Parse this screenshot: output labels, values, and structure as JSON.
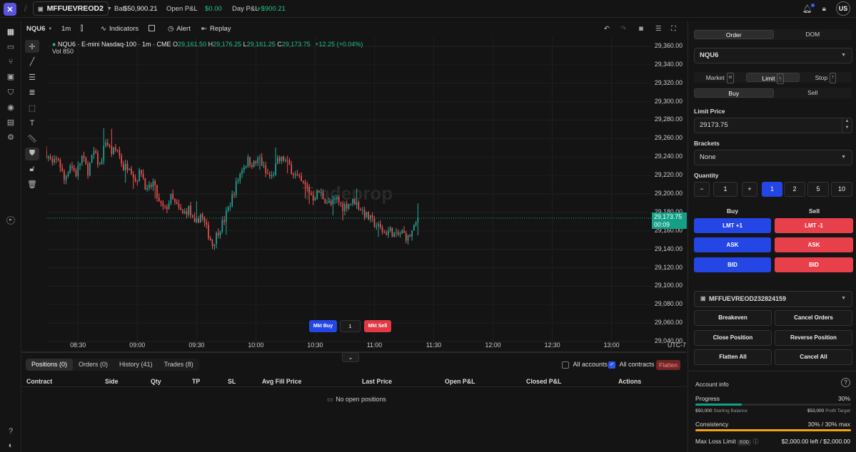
{
  "topbar": {
    "account": "MFFUEVREOD2",
    "bal_label": "Bal",
    "bal_value": "$50,900.21",
    "open_pnl_label": "Open P&L",
    "open_pnl_value": "$0.00",
    "day_pnl_label": "Day P&L",
    "day_pnl_value": "+$900.21",
    "user_initials": "US"
  },
  "chart_toolbar": {
    "symbol": "NQU6",
    "interval": "1m",
    "indicators": "Indicators",
    "alert": "Alert",
    "replay": "Replay"
  },
  "legend": {
    "title": "NQU6 · E-mini Nasdaq-100 · 1m · CME",
    "o_label": "O",
    "o": "29,161.50",
    "h_label": "H",
    "h": "29,176.25",
    "l_label": "L",
    "l": "29,161.25",
    "c_label": "C",
    "c": "29,173.75",
    "change": "+12.25 (+0.04%)",
    "vol": "Vol 850"
  },
  "watermark": "Tradeprop",
  "current_price": "29,173.75",
  "countdown": "00:09",
  "timezone": "UTC-7",
  "mkt": {
    "buy": "Mkt Buy",
    "qty": "1",
    "sell": "Mkt Sell"
  },
  "colors": {
    "up": "#26a69a",
    "down": "#ef5350",
    "accent": "#2446e5",
    "sell": "#e8404b",
    "progress": "#14a087",
    "consistency": "#f4a316"
  },
  "chart_data": {
    "type": "candlestick",
    "symbol": "NQU6",
    "interval": "1m",
    "ylim": [
      29030,
      29370
    ],
    "y_ticks": [
      29040,
      29060,
      29080,
      29100,
      29120,
      29140,
      29160,
      29180,
      29200,
      29220,
      29240,
      29260,
      29280,
      29300,
      29320,
      29340,
      29360
    ],
    "y_tick_labels": [
      "29,040.00",
      "29,060.00",
      "29,080.00",
      "29,100.00",
      "29,120.00",
      "29,140.00",
      "29,160.00",
      "29,180.00",
      "29,200.00",
      "29,220.00",
      "29,240.00",
      "29,260.00",
      "29,280.00",
      "29,300.00",
      "29,320.00",
      "29,340.00",
      "29,360.00"
    ],
    "x_ticks": [
      "08:30",
      "09:00",
      "09:30",
      "10:00",
      "10:30",
      "11:00",
      "11:30",
      "12:00",
      "12:30",
      "13:00"
    ],
    "x_tick_minutes": [
      510,
      540,
      570,
      600,
      630,
      660,
      690,
      720,
      750,
      780
    ],
    "x_range_minutes": [
      494,
      800
    ],
    "close_path": [
      [
        494,
        29244
      ],
      [
        497,
        29232
      ],
      [
        500,
        29238
      ],
      [
        503,
        29215
      ],
      [
        506,
        29232
      ],
      [
        509,
        29222
      ],
      [
        512,
        29240
      ],
      [
        515,
        29225
      ],
      [
        518,
        29245
      ],
      [
        521,
        29230
      ],
      [
        524,
        29258
      ],
      [
        527,
        29245
      ],
      [
        530,
        29248
      ],
      [
        533,
        29228
      ],
      [
        536,
        29232
      ],
      [
        539,
        29215
      ],
      [
        542,
        29225
      ],
      [
        545,
        29202
      ],
      [
        548,
        29212
      ],
      [
        551,
        29190
      ],
      [
        554,
        29182
      ],
      [
        557,
        29196
      ],
      [
        560,
        29186
      ],
      [
        563,
        29178
      ],
      [
        566,
        29184
      ],
      [
        569,
        29165
      ],
      [
        572,
        29178
      ],
      [
        575,
        29162
      ],
      [
        578,
        29145
      ],
      [
        581,
        29160
      ],
      [
        584,
        29172
      ],
      [
        587,
        29190
      ],
      [
        590,
        29210
      ],
      [
        593,
        29228
      ],
      [
        596,
        29236
      ],
      [
        599,
        29232
      ],
      [
        602,
        29238
      ],
      [
        605,
        29222
      ],
      [
        608,
        29218
      ],
      [
        611,
        29235
      ],
      [
        614,
        29238
      ],
      [
        617,
        29230
      ],
      [
        620,
        29220
      ],
      [
        623,
        29212
      ],
      [
        626,
        29206
      ],
      [
        629,
        29196
      ],
      [
        632,
        29202
      ],
      [
        635,
        29194
      ],
      [
        638,
        29188
      ],
      [
        641,
        29194
      ],
      [
        644,
        29186
      ],
      [
        647,
        29190
      ],
      [
        650,
        29192
      ],
      [
        653,
        29184
      ],
      [
        656,
        29176
      ],
      [
        659,
        29170
      ],
      [
        662,
        29164
      ],
      [
        665,
        29158
      ],
      [
        668,
        29160
      ],
      [
        671,
        29154
      ],
      [
        674,
        29158
      ],
      [
        677,
        29152
      ],
      [
        680,
        29162
      ],
      [
        682,
        29174
      ]
    ],
    "last_price": 29173.75
  },
  "positions_tabs": [
    "Positions (0)",
    "Orders (0)",
    "History (41)",
    "Trades (8)"
  ],
  "filters": {
    "all_accounts": "All accounts",
    "all_contracts": "All contracts",
    "flatten": "Flatten"
  },
  "table_headers": [
    "Contract",
    "Side",
    "Qty",
    "TP",
    "SL",
    "Avg Fill Price",
    "Last Price",
    "Open P&L",
    "Closed P&L",
    "Actions"
  ],
  "empty_text": "No open positions",
  "panel": {
    "tabs": [
      "Order",
      "DOM"
    ],
    "symbol": "NQU6",
    "order_types": [
      {
        "label": "Market",
        "key": "M"
      },
      {
        "label": "Limit",
        "key": "L"
      },
      {
        "label": "Stop",
        "key": "T"
      }
    ],
    "side_tabs": [
      "Buy",
      "Sell"
    ],
    "limit_price_label": "Limit Price",
    "limit_price": "29173.75",
    "brackets_label": "Brackets",
    "brackets": "None",
    "quantity_label": "Quantity",
    "quantity": "1",
    "presets": [
      "1",
      "2",
      "5",
      "10"
    ],
    "buy_header": "Buy",
    "sell_header": "Sell",
    "buy_buttons": [
      "LMT +1",
      "ASK",
      "BID"
    ],
    "sell_buttons": [
      "LMT -1",
      "ASK",
      "BID"
    ],
    "account_select": "MFFUEVREOD232824159",
    "actions": [
      "Breakeven",
      "Cancel Orders",
      "Close Position",
      "Reverse Position",
      "Flatten All",
      "Cancel All"
    ],
    "account_info": "Account info",
    "progress_label": "Progress",
    "progress_value": "30%",
    "progress_fraction": 0.3,
    "starting_balance": "$50,000",
    "starting_balance_label": "Starting Balance",
    "profit_target": "$53,000",
    "profit_target_label": "Profit Target",
    "consistency_label": "Consistency",
    "consistency_value": "30% / 30% max",
    "consistency_fraction": 1.0,
    "max_loss_label": "Max Loss Limit",
    "max_loss_badge": "EOD",
    "max_loss_value": "$2,000.00 left / $2,000.00"
  }
}
